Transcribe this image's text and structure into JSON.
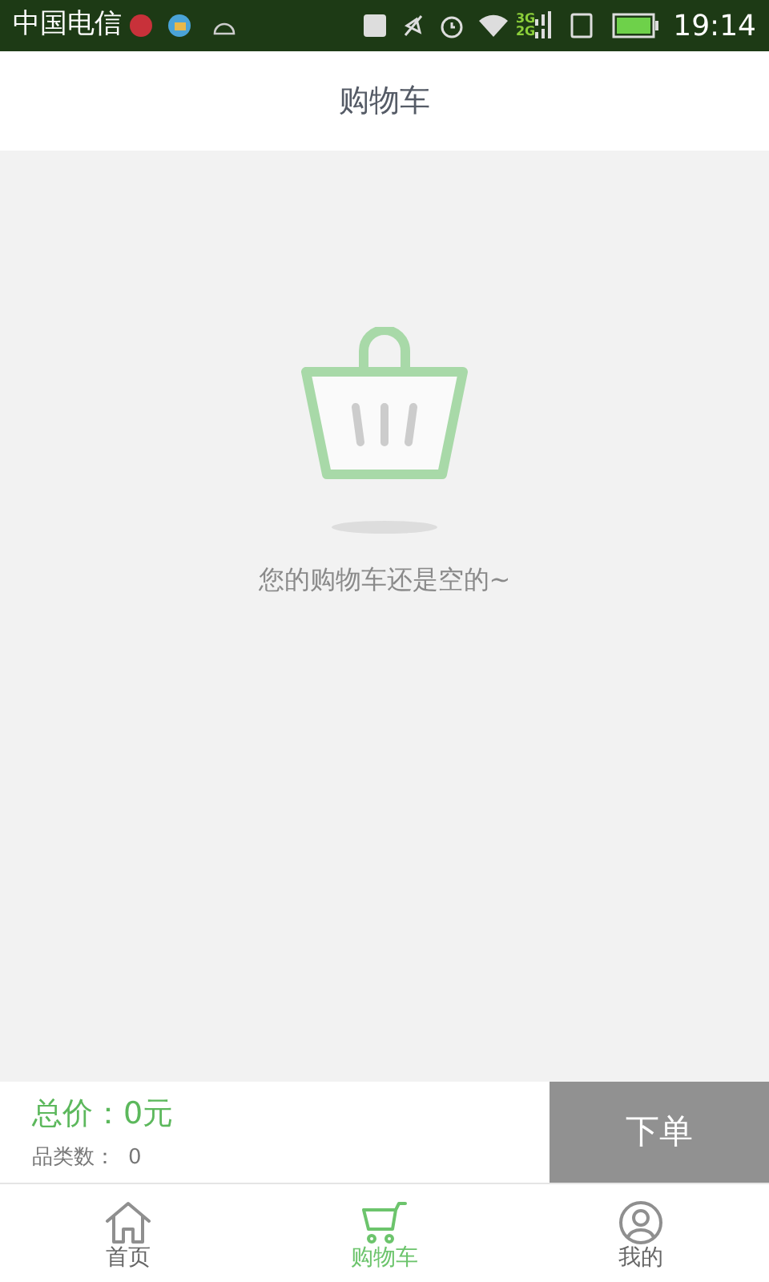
{
  "status_bar": {
    "carrier": "中国电信",
    "network_top": "3G",
    "network_bottom": "2G",
    "time": "19:14"
  },
  "header": {
    "title": "购物车"
  },
  "empty_state": {
    "message": "您的购物车还是空的~"
  },
  "summary": {
    "total_label": "总价：",
    "total_value": "0元",
    "count_label": "品类数：",
    "count_value": "0",
    "order_button": "下单"
  },
  "tabs": [
    {
      "label": "首页",
      "kind": "home",
      "selected": false
    },
    {
      "label": "购物车",
      "kind": "cart",
      "selected": true
    },
    {
      "label": "我的",
      "kind": "user",
      "selected": false
    }
  ]
}
